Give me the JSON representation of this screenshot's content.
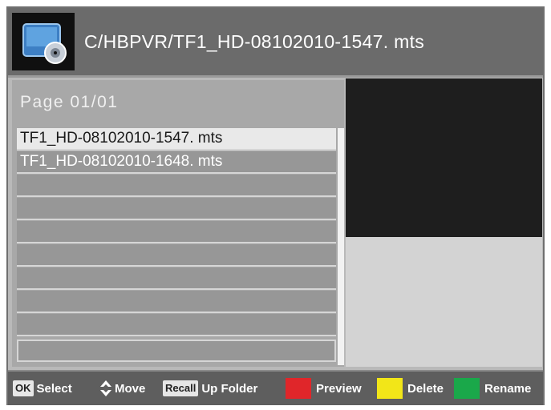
{
  "header": {
    "path": "C/HBPVR/TF1_HD-08102010-1547. mts",
    "icon": "disc-icon"
  },
  "page": {
    "label": "Page 01/01"
  },
  "files": [
    {
      "name": "TF1_HD-08102010-1547. mts",
      "selected": true
    },
    {
      "name": "TF1_HD-08102010-1648. mts",
      "selected": false
    },
    {
      "name": "",
      "selected": false
    },
    {
      "name": "",
      "selected": false
    },
    {
      "name": "",
      "selected": false
    },
    {
      "name": "",
      "selected": false
    },
    {
      "name": "",
      "selected": false
    },
    {
      "name": "",
      "selected": false
    },
    {
      "name": "",
      "selected": false
    },
    {
      "name": "",
      "selected": false
    }
  ],
  "footer": {
    "ok_key": "OK",
    "select_label": "Select",
    "move_label": "Move",
    "recall_key": "Recall",
    "up_folder_label": "Up  Folder",
    "preview_label": "Preview",
    "delete_label": "Delete",
    "rename_label": "Rename"
  },
  "colors": {
    "red_key": "#e0262a",
    "yellow_key": "#f2e618",
    "green_key": "#1aa84a"
  }
}
